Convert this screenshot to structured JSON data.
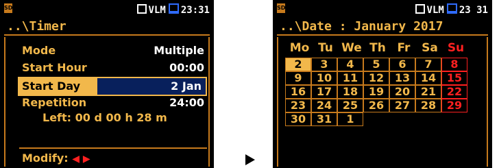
{
  "left_screen": {
    "status": {
      "mode": "VLM",
      "time": "23:31"
    },
    "title": "..\\Timer",
    "rows": [
      {
        "label": "Mode",
        "value": "Multiple"
      },
      {
        "label": "Start Hour",
        "value": "00:00"
      },
      {
        "label": "Start Day",
        "value": "2 Jan"
      },
      {
        "label": "Repetition",
        "value": "24:00"
      }
    ],
    "left_info": "Left: 00 d 00 h 28 m",
    "modify_label": "Modify:",
    "modify_arrows": "◀ ▶"
  },
  "right_screen": {
    "status": {
      "mode": "VLM",
      "time": "23 31"
    },
    "title": "..\\Date : January 2017",
    "weekdays": [
      "Mo",
      "Tu",
      "We",
      "Th",
      "Fr",
      "Sa",
      "Su"
    ],
    "days": [
      [
        "2",
        "3",
        "4",
        "5",
        "6",
        "7",
        "8"
      ],
      [
        "9",
        "10",
        "11",
        "12",
        "13",
        "14",
        "15"
      ],
      [
        "16",
        "17",
        "18",
        "19",
        "20",
        "21",
        "22"
      ],
      [
        "23",
        "24",
        "25",
        "26",
        "27",
        "28",
        "29"
      ],
      [
        "30",
        "31",
        "1",
        "",
        "",
        "",
        ""
      ]
    ],
    "selected_day": "2"
  },
  "colors": {
    "accent": "#f2b84b",
    "frame": "#c77a1c",
    "sunday": "#ff2020",
    "highlight_value_bg": "#08205c"
  }
}
